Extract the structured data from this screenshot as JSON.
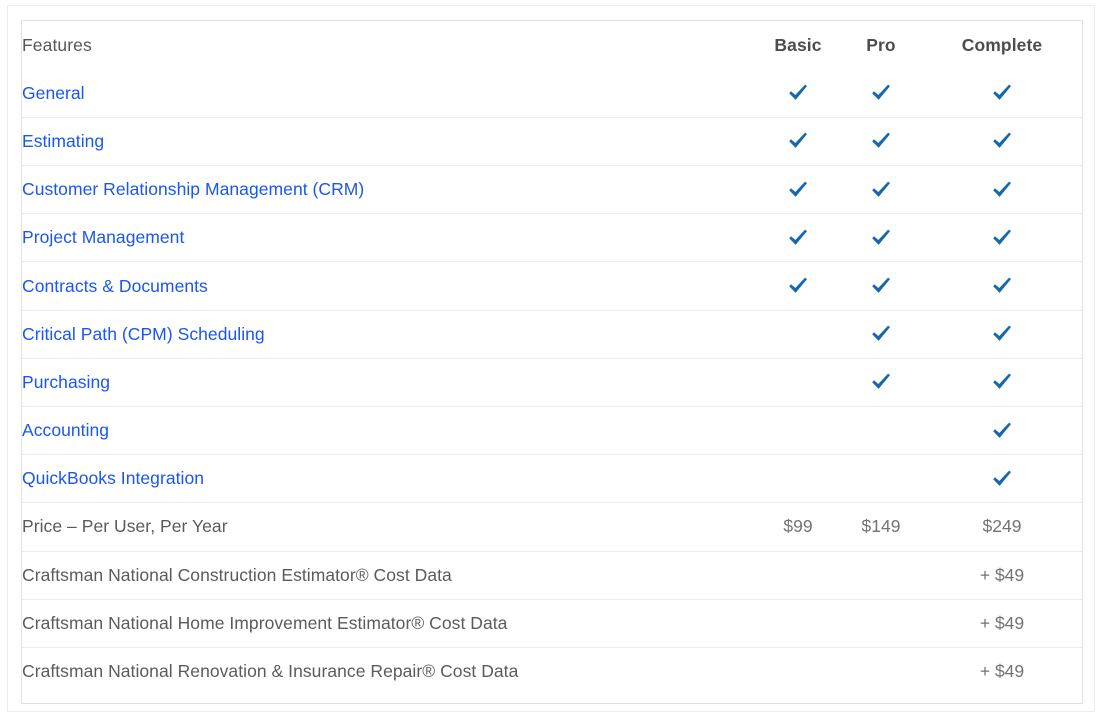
{
  "table": {
    "columns": [
      {
        "key": "feature",
        "label": "Features",
        "align": "left"
      },
      {
        "key": "basic",
        "label": "Basic",
        "align": "center"
      },
      {
        "key": "pro",
        "label": "Pro",
        "align": "center"
      },
      {
        "key": "complete",
        "label": "Complete",
        "align": "center"
      }
    ],
    "rows": [
      {
        "feature": "General",
        "type": "link",
        "basic": "check",
        "pro": "check",
        "complete": "check"
      },
      {
        "feature": "Estimating",
        "type": "link",
        "basic": "check",
        "pro": "check",
        "complete": "check"
      },
      {
        "feature": "Customer Relationship Management (CRM)",
        "type": "link",
        "basic": "check",
        "pro": "check",
        "complete": "check"
      },
      {
        "feature": "Project Management",
        "type": "link",
        "basic": "check",
        "pro": "check",
        "complete": "check"
      },
      {
        "feature": "Contracts & Documents",
        "type": "link",
        "basic": "check",
        "pro": "check",
        "complete": "check"
      },
      {
        "feature": "Critical Path (CPM) Scheduling",
        "type": "link",
        "basic": "",
        "pro": "check",
        "complete": "check"
      },
      {
        "feature": "Purchasing",
        "type": "link",
        "basic": "",
        "pro": "check",
        "complete": "check"
      },
      {
        "feature": "Accounting",
        "type": "link",
        "basic": "",
        "pro": "",
        "complete": "check"
      },
      {
        "feature": "QuickBooks Integration",
        "type": "link",
        "basic": "",
        "pro": "",
        "complete": "check"
      },
      {
        "feature": "Price – Per User, Per Year",
        "type": "plain",
        "basic": "$99",
        "pro": "$149",
        "complete": "$249"
      },
      {
        "feature": "Craftsman National Construction Estimator® Cost Data",
        "type": "plain",
        "basic": "",
        "pro": "",
        "complete": "+ $49"
      },
      {
        "feature": "Craftsman National Home Improvement Estimator® Cost Data",
        "type": "plain",
        "basic": "",
        "pro": "",
        "complete": "+ $49"
      },
      {
        "feature": "Craftsman National Renovation & Insurance Repair® Cost Data",
        "type": "plain",
        "basic": "",
        "pro": "",
        "complete": "+ $49"
      }
    ]
  },
  "icons": {
    "check": "check-icon"
  },
  "colors": {
    "link": "#1a56f2",
    "check": "#1368b0",
    "header_text": "#4d4d4d",
    "body_text": "#5b5b5b",
    "price_text": "#737373",
    "row_border": "#ececec",
    "card_border": "#e2e2e2",
    "outer_border": "#ededed",
    "background": "#ffffff"
  }
}
